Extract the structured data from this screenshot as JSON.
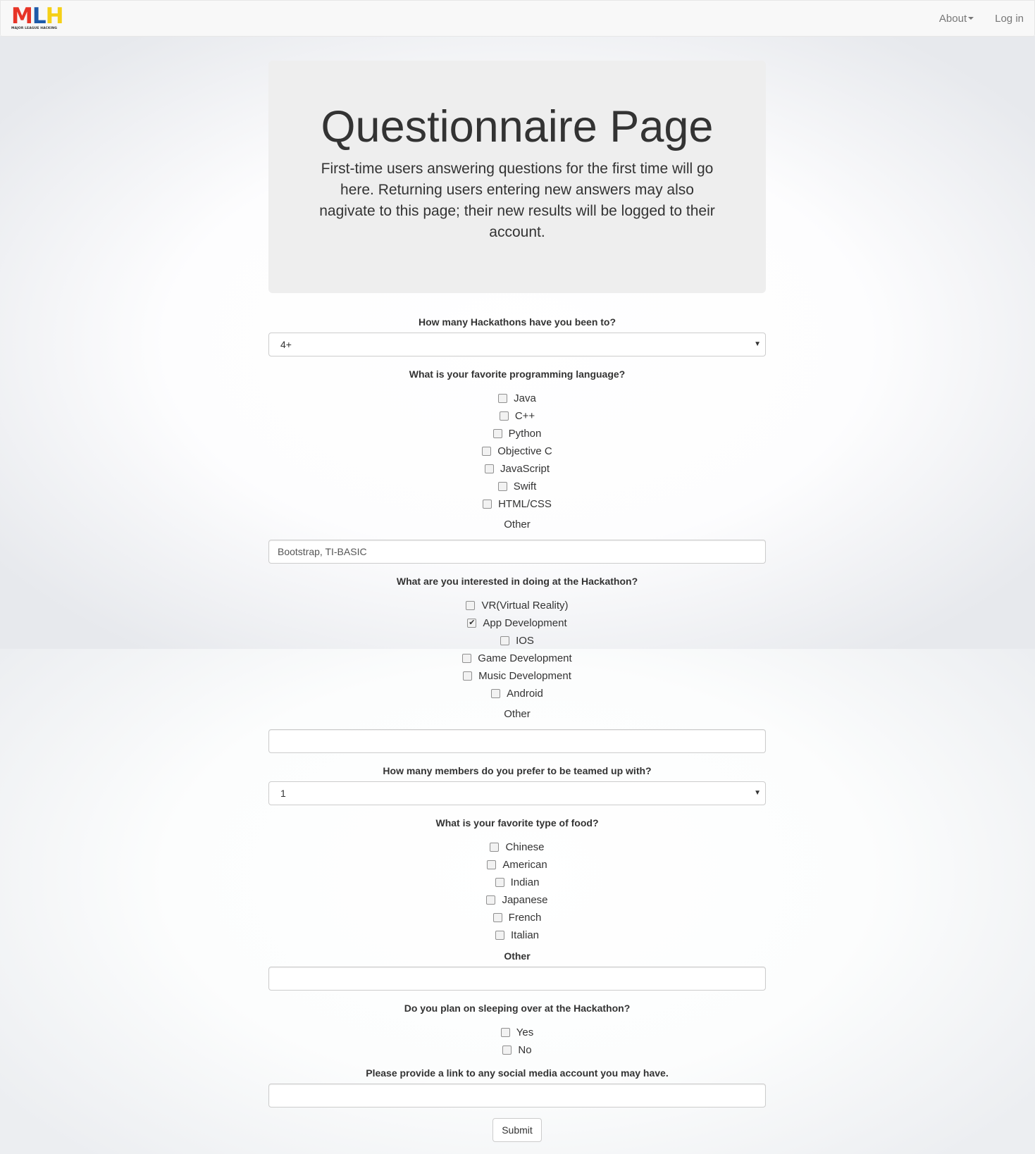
{
  "brand": {
    "logo_text": [
      "M",
      "L",
      "H"
    ],
    "logo_colors": [
      "#e73427",
      "#1e5aa9",
      "#f5d017"
    ],
    "tagline": "MAJOR LEAGUE HACKING"
  },
  "nav": {
    "about_label": "About",
    "login_label": "Log in"
  },
  "hero": {
    "title": "Questionnaire Page",
    "subtitle": "First-time users answering questions for the first time will go here. Returning users entering new answers may also nagivate to this page; their new results will be logged to their account."
  },
  "q_hackathons": {
    "label": "How many Hackathons have you been to?",
    "selected": "4+"
  },
  "q_language": {
    "label": "What is your favorite programming language?",
    "options": [
      {
        "label": "Java",
        "checked": false
      },
      {
        "label": "C++",
        "checked": false
      },
      {
        "label": "Python",
        "checked": false
      },
      {
        "label": "Objective C",
        "checked": false
      },
      {
        "label": "JavaScript",
        "checked": false
      },
      {
        "label": "Swift",
        "checked": false
      },
      {
        "label": "HTML/CSS",
        "checked": false
      }
    ],
    "other_label": "Other",
    "other_value": "Bootstrap, TI-BASIC"
  },
  "q_interest": {
    "label": "What are you interested in doing at the Hackathon?",
    "options": [
      {
        "label": "VR(Virtual Reality)",
        "checked": false
      },
      {
        "label": "App Development",
        "checked": true
      },
      {
        "label": "IOS",
        "checked": false
      },
      {
        "label": "Game Development",
        "checked": false
      },
      {
        "label": "Music Development",
        "checked": false
      },
      {
        "label": "Android",
        "checked": false
      }
    ],
    "other_label": "Other",
    "other_value": ""
  },
  "q_team": {
    "label": "How many members do you prefer to be teamed up with?",
    "selected": "1"
  },
  "q_food": {
    "label": "What is your favorite type of food?",
    "options": [
      {
        "label": "Chinese",
        "checked": false
      },
      {
        "label": "American",
        "checked": false
      },
      {
        "label": "Indian",
        "checked": false
      },
      {
        "label": "Japanese",
        "checked": false
      },
      {
        "label": "French",
        "checked": false
      },
      {
        "label": "Italian",
        "checked": false
      }
    ],
    "other_label": "Other",
    "other_value": ""
  },
  "q_sleep": {
    "label": "Do you plan on sleeping over at the Hackathon?",
    "options": [
      {
        "label": "Yes",
        "checked": false
      },
      {
        "label": "No",
        "checked": false
      }
    ]
  },
  "q_social": {
    "label": "Please provide a link to any social media account you may have.",
    "value": ""
  },
  "submit_label": "Submit"
}
